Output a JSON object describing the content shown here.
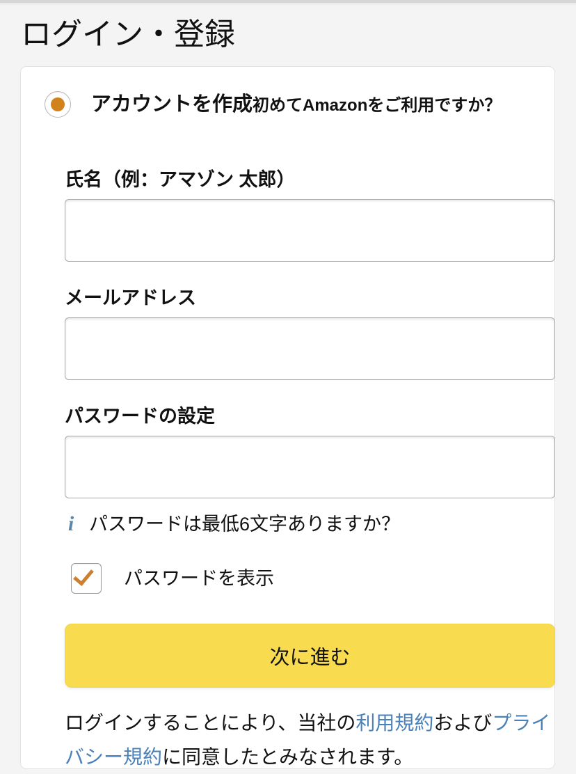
{
  "page": {
    "title": "ログイン・登録"
  },
  "account_option": {
    "radio_selected": true,
    "title": "アカウントを作成",
    "subtitle": "初めてAmazonをご利用ですか？"
  },
  "form": {
    "name": {
      "label": "氏名（例：アマゾン 太郎）",
      "value": "",
      "placeholder": ""
    },
    "email": {
      "label": "メールアドレス",
      "value": "",
      "placeholder": ""
    },
    "password": {
      "label": "パスワードの設定",
      "value": "",
      "placeholder": ""
    },
    "password_hint": {
      "icon": "info-icon",
      "icon_glyph": "i",
      "text": "パスワードは最低6文字ありますか？"
    },
    "show_password": {
      "label": "パスワードを表示",
      "checked": true
    },
    "submit_label": "次に進む"
  },
  "terms": {
    "prefix": "ログインすることにより、当社の",
    "link1": "利用規約",
    "middle": "および",
    "link2": "プライバシー規約",
    "suffix": "に同意したとみなされます。"
  },
  "colors": {
    "page_background": "#f4f4f4",
    "card_background": "#ffffff",
    "accent_orange": "#d2821a",
    "button_yellow": "#f8db4f",
    "link_blue": "#4a81b8",
    "info_blue": "#5b87a8",
    "check_orange": "#cc7f2e",
    "text": "#111111",
    "border_gray": "#a9a9a9"
  }
}
